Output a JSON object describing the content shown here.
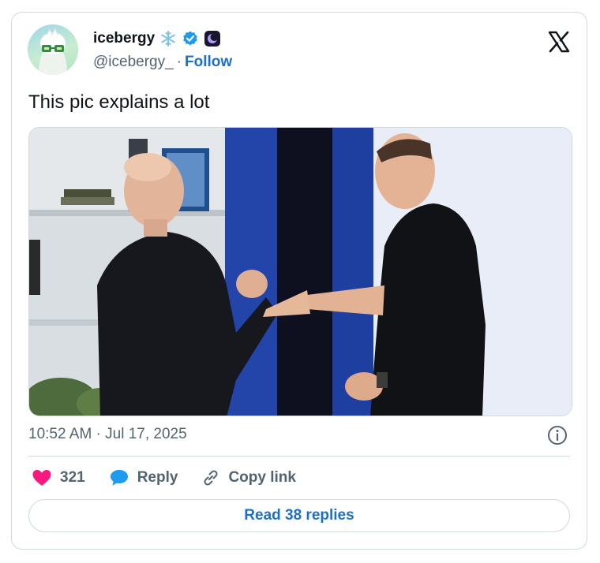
{
  "author": {
    "display_name": "icebergy",
    "handle": "@icebergy_",
    "separator": "·",
    "follow_label": "Follow",
    "badges": [
      "snowflake-icon",
      "verified-badge-icon",
      "moon-app-icon"
    ],
    "verified_color": "#1d9bf0"
  },
  "tweet": {
    "text": "This pic explains a lot",
    "timestamp": "10:52 AM · Jul 17, 2025"
  },
  "actions": {
    "like_count": "321",
    "reply_label": "Reply",
    "copy_label": "Copy link"
  },
  "footer": {
    "read_replies_label": "Read 38 replies"
  },
  "colors": {
    "link": "#1d70c9",
    "like": "#f91880",
    "secondary_text": "#536471",
    "border": "#cfd9de"
  }
}
